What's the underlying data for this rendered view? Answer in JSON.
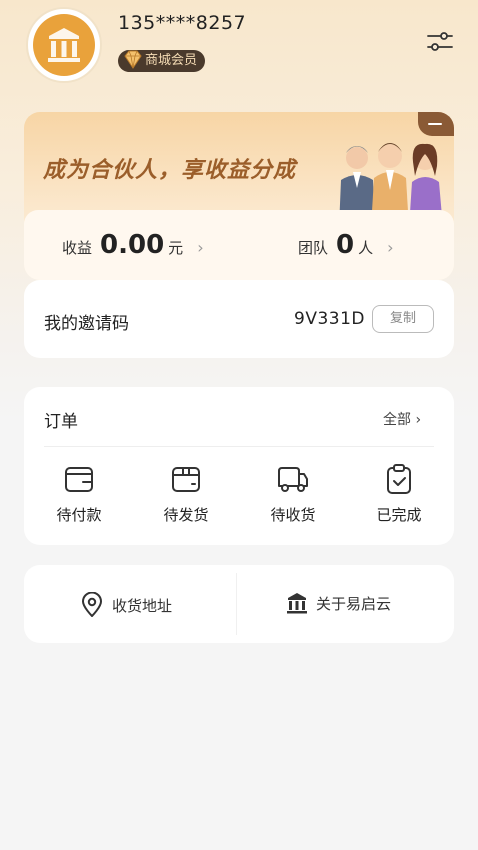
{
  "profile": {
    "phone": "135****8257",
    "member_badge": "商城会员",
    "avatar_icon": "building-logo-icon"
  },
  "header": {
    "settings_icon": "settings-sliders-icon"
  },
  "partner": {
    "title": "成为合伙人，享收益分成",
    "earnings_label": "收益",
    "earnings_value": "0.00",
    "earnings_unit": "元",
    "team_label": "团队",
    "team_value": "0",
    "team_unit": "人",
    "chevron": "›"
  },
  "invite": {
    "label": "我的邀请码",
    "code": "9V331D",
    "copy_label": "复制"
  },
  "orders": {
    "title": "订单",
    "all_label": "全部 ›",
    "items": [
      {
        "label": "待付款",
        "icon": "wallet-icon"
      },
      {
        "label": "待发货",
        "icon": "box-icon"
      },
      {
        "label": "待收货",
        "icon": "truck-icon"
      },
      {
        "label": "已完成",
        "icon": "clipboard-check-icon"
      }
    ]
  },
  "misc": {
    "address_label": "收货地址",
    "about_label": "关于易启云"
  },
  "colors": {
    "accent": "#e9a23b",
    "title_brown": "#9b5e2a",
    "badge_bg": "#4a3a2c"
  }
}
